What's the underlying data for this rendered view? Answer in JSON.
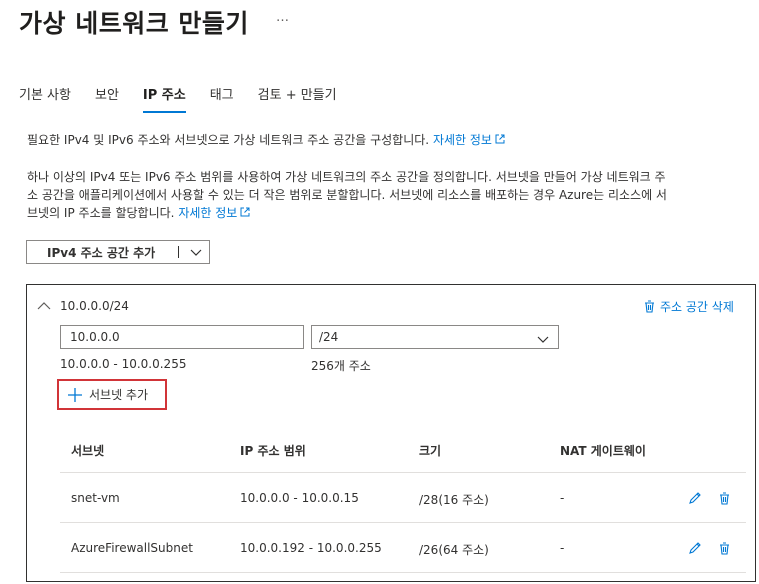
{
  "page": {
    "title": "가상 네트워크 만들기",
    "more": "…"
  },
  "tabs": [
    {
      "label": "기본 사항",
      "active": false
    },
    {
      "label": "보안",
      "active": false
    },
    {
      "label": "IP 주소",
      "active": true
    },
    {
      "label": "태그",
      "active": false
    },
    {
      "label": "검토 + 만들기",
      "active": false
    }
  ],
  "intro": {
    "text": "필요한 IPv4 및 IPv6 주소와 서브넷으로 가상 네트워크 주소 공간을 구성합니다.",
    "link": "자세한 정보"
  },
  "description": {
    "line1": "하나 이상의 IPv4 또는 IPv6 주소 범위를 사용하여 가상 네트워크의 주소 공간을 정의합니다. 서브넷을 만들어 가상 네트워크 주",
    "line2": "소 공간을 애플리케이션에서 사용할 수 있는 더 작은 범위로 분할합니다. 서브넷에 리소스를 배포하는 경우 Azure는 리소스에 서",
    "line3": "브넷의 IP 주소를 할당합니다.",
    "link": "자세한 정보"
  },
  "add_space_button": "IPv4 주소 공간 추가",
  "address_space": {
    "title": "10.0.0.0/24",
    "delete_label": "주소 공간 삭제",
    "ip_value": "10.0.0.0",
    "cidr_value": "/24",
    "range_text": "10.0.0.0 - 10.0.0.255",
    "count_text": "256개 주소",
    "add_subnet_label": "서브넷 추가"
  },
  "subnet_table": {
    "headers": [
      "서브넷",
      "IP 주소 범위",
      "크기",
      "NAT 게이트웨이"
    ],
    "rows": [
      {
        "name": "snet-vm",
        "range": "10.0.0.0 - 10.0.0.15",
        "size": "/28(16 주소)",
        "nat": "-"
      },
      {
        "name": "AzureFirewallSubnet",
        "range": "10.0.0.192 - 10.0.0.255",
        "size": "/26(64 주소)",
        "nat": "-"
      }
    ]
  },
  "colors": {
    "accent": "#0078d4",
    "highlight_border": "#d13438",
    "text": "#323130"
  }
}
